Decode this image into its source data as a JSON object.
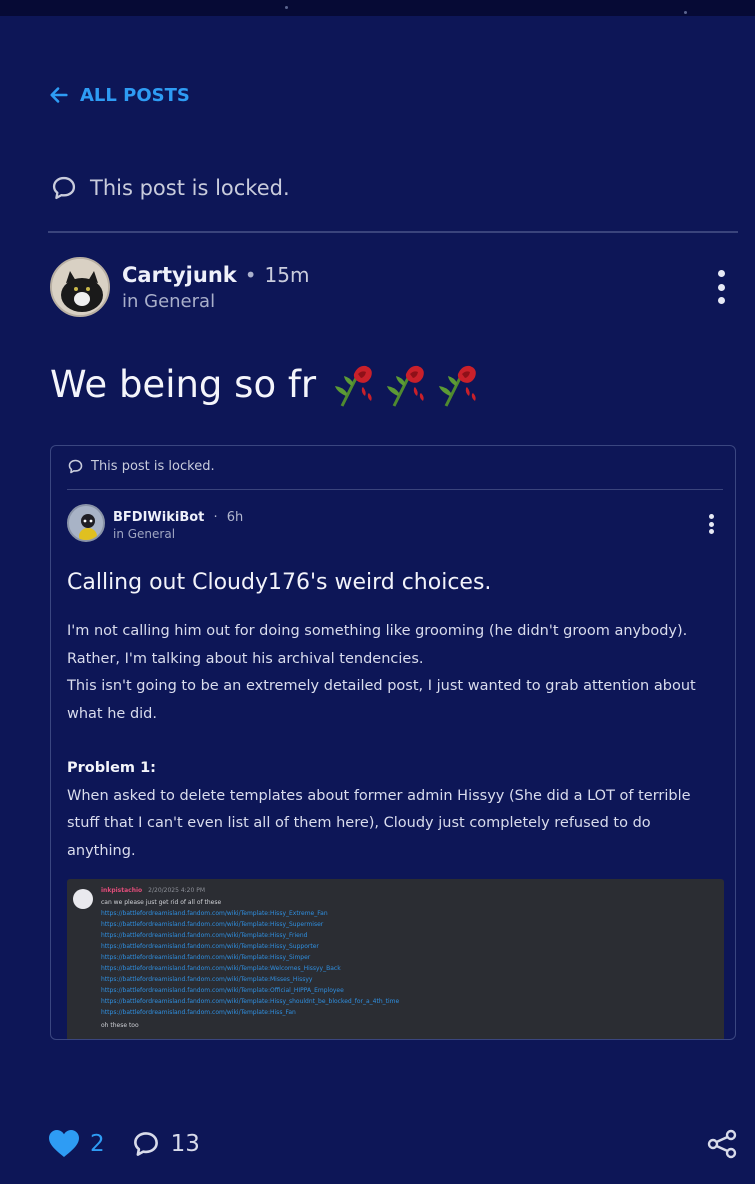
{
  "nav": {
    "back_label": "ALL POSTS"
  },
  "post": {
    "locked_text": "This post is locked.",
    "author": "Cartyjunk",
    "time": "15m",
    "category": "in General",
    "title": "We being so fr",
    "title_emoji": [
      "wilted-rose",
      "wilted-rose",
      "wilted-rose"
    ]
  },
  "shared_post": {
    "locked_text": "This post is locked.",
    "author": "BFDIWikiBot",
    "time": "6h",
    "category": "in General",
    "title": "Calling out Cloudy176's weird choices.",
    "body_lines": [
      "I'm not calling him out for doing something like grooming (he didn't groom anybody).",
      "Rather, I'm talking about his archival tendencies.",
      "This isn't going to be an extremely detailed post, I just wanted to grab attention about",
      "what he did."
    ],
    "problem_heading": "Problem 1:",
    "problem_lines": [
      "When asked to delete templates about former admin Hissyy (She did a LOT of terrible",
      "stuff that I can't even list all of them here), Cloudy just completely refused to do",
      "anything."
    ],
    "screenshot": {
      "username": "inkpistachio",
      "timestamp": "2/20/2025 4:20 PM",
      "message": "can we please just get rid of all of these",
      "links": [
        "https://battlefordreamisland.fandom.com/wiki/Template:Hissy_Extreme_Fan",
        "https://battlefordreamisland.fandom.com/wiki/Template:Hissy_Supermiser",
        "https://battlefordreamisland.fandom.com/wiki/Template:Hissy_Friend",
        "https://battlefordreamisland.fandom.com/wiki/Template:Hissy_Supporter",
        "https://battlefordreamisland.fandom.com/wiki/Template:Hissy_Simper",
        "https://battlefordreamisland.fandom.com/wiki/Template:Welcomes_Hissyy_Back",
        "https://battlefordreamisland.fandom.com/wiki/Template:Misses_Hissyy",
        "https://battlefordreamisland.fandom.com/wiki/Template:Official_HIPPA_Employee",
        "https://battlefordreamisland.fandom.com/wiki/Template:Hissy_shouldnt_be_blocked_for_a_4th_time",
        "https://battlefordreamisland.fandom.com/wiki/Template:Hiss_Fan"
      ],
      "footer_text": "oh these too"
    }
  },
  "footer": {
    "likes": "2",
    "comments": "13"
  },
  "colors": {
    "background": "#0d1657",
    "accent": "#2e9cf4",
    "divider": "#3a447c"
  }
}
